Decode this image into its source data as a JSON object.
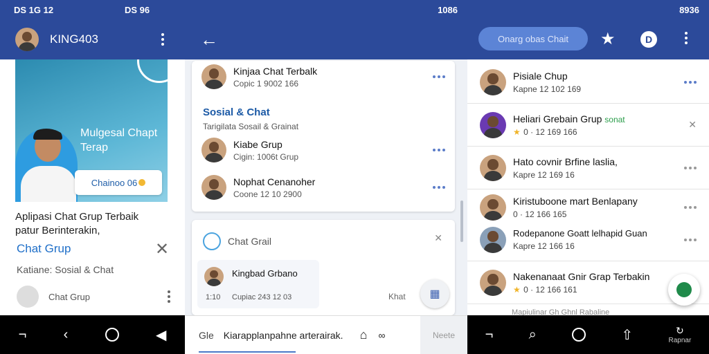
{
  "screen1": {
    "status_left": "DS 1G 12",
    "status_right": "DS 96",
    "app_title": "KING403",
    "banner": {
      "title": "Mulgesal Chapt Terap",
      "button_label": "Chainoo 06"
    },
    "description": "Aplipasi Chat Grup Terbaik patur Berinterakin,",
    "link": "Chat Grup",
    "category": "Katiane: Sosial & Chat",
    "row_label": "Chat Grup",
    "nav": [
      "¬",
      "‹",
      "○",
      "◀"
    ]
  },
  "screen2": {
    "status_right": "1086",
    "items_top": [
      {
        "name": "Kinjaa Chat Terbalk",
        "sub": "Copic 1 9002 166"
      }
    ],
    "section": {
      "title": "Sosial & Chat",
      "subtitle": "Tarigilata Sosail & Grainat"
    },
    "items_section": [
      {
        "name": "Kiabe Grup",
        "sub": "Cigin: 1006t Grup"
      },
      {
        "name": "Nophat Cenanoher",
        "sub": "Coone 12 10 2900"
      }
    ],
    "card2": {
      "title": "Chat Grail",
      "item_name": "Kingbad Grbano",
      "item_code": "1:10",
      "item_sub": "Cupiac 243 12 03",
      "khat_label": "Khat"
    },
    "bottom_bar": {
      "prefix": "Gle",
      "text": "Kiarapplanpahne arterairak.",
      "send_label": "Neete"
    }
  },
  "screen3": {
    "status_right": "8936",
    "search_pill": "Onarg obas Chait",
    "rows": [
      {
        "name": "Pisiale Chup",
        "sub": "Kapne 12 102 169",
        "rating": 0
      },
      {
        "name": "Heliari Grebain Grup",
        "tag": "sonat",
        "sub": "0 · 12 169 166",
        "rating": 2
      },
      {
        "name": "Hato covnir Brfine laslia,",
        "sub": "Kapre 12 169 16",
        "rating": 1
      },
      {
        "name": "Kiristuboone mart Benlapany",
        "sub": "0 · 12 166 165",
        "rating": 0
      },
      {
        "name": "Rodepanone Goatt lelhapid Guan",
        "sub": "Kapre 12 166 16",
        "rating": 1
      },
      {
        "name": "Nakenanaat Gnir Grap Terbakin",
        "sub": "0 · 12 166 161",
        "rating": 2
      }
    ],
    "footer_row": "Mapiulinar Gh Ghnl Rabaline",
    "nav_label": "Rapnar",
    "colors": {
      "primary": "#2c4a9a",
      "accent_star": "#f0b429",
      "link": "#1f6fc8"
    }
  }
}
